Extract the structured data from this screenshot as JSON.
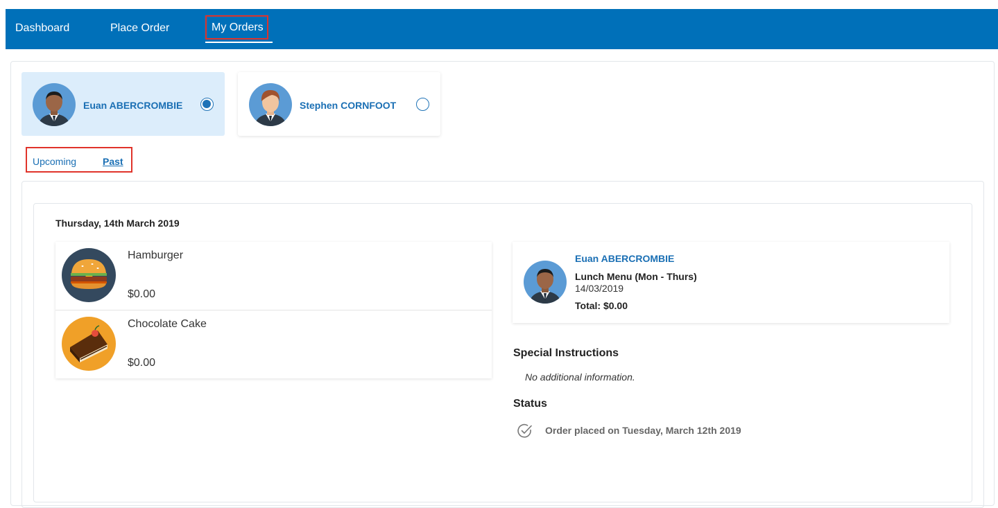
{
  "nav": {
    "items": [
      "Dashboard",
      "Place Order",
      "My Orders"
    ],
    "active": "My Orders"
  },
  "children": [
    {
      "name": "Euan ABERCROMBIE",
      "selected": true
    },
    {
      "name": "Stephen CORNFOOT",
      "selected": false
    }
  ],
  "tabs": {
    "upcoming": "Upcoming",
    "past": "Past",
    "active": "Past"
  },
  "order": {
    "date": "Thursday, 14th March 2019",
    "items": [
      {
        "name": "Hamburger",
        "price": "$0.00",
        "icon": "hamburger-icon"
      },
      {
        "name": "Chocolate Cake",
        "price": "$0.00",
        "icon": "chocolate-cake-icon"
      }
    ],
    "summary": {
      "child_name": "Euan ABERCROMBIE",
      "menu": "Lunch Menu (Mon - Thurs)",
      "date": "14/03/2019",
      "total": "Total: $0.00"
    },
    "special_instructions": {
      "heading": "Special Instructions",
      "text": "No additional information."
    },
    "status": {
      "heading": "Status",
      "text": "Order placed on Tuesday, March 12th 2019"
    }
  },
  "colors": {
    "nav_bg": "#0070b9",
    "accent": "#1a6fb4",
    "highlight_border": "#e0332a",
    "selected_card_bg": "#dcedfb"
  }
}
